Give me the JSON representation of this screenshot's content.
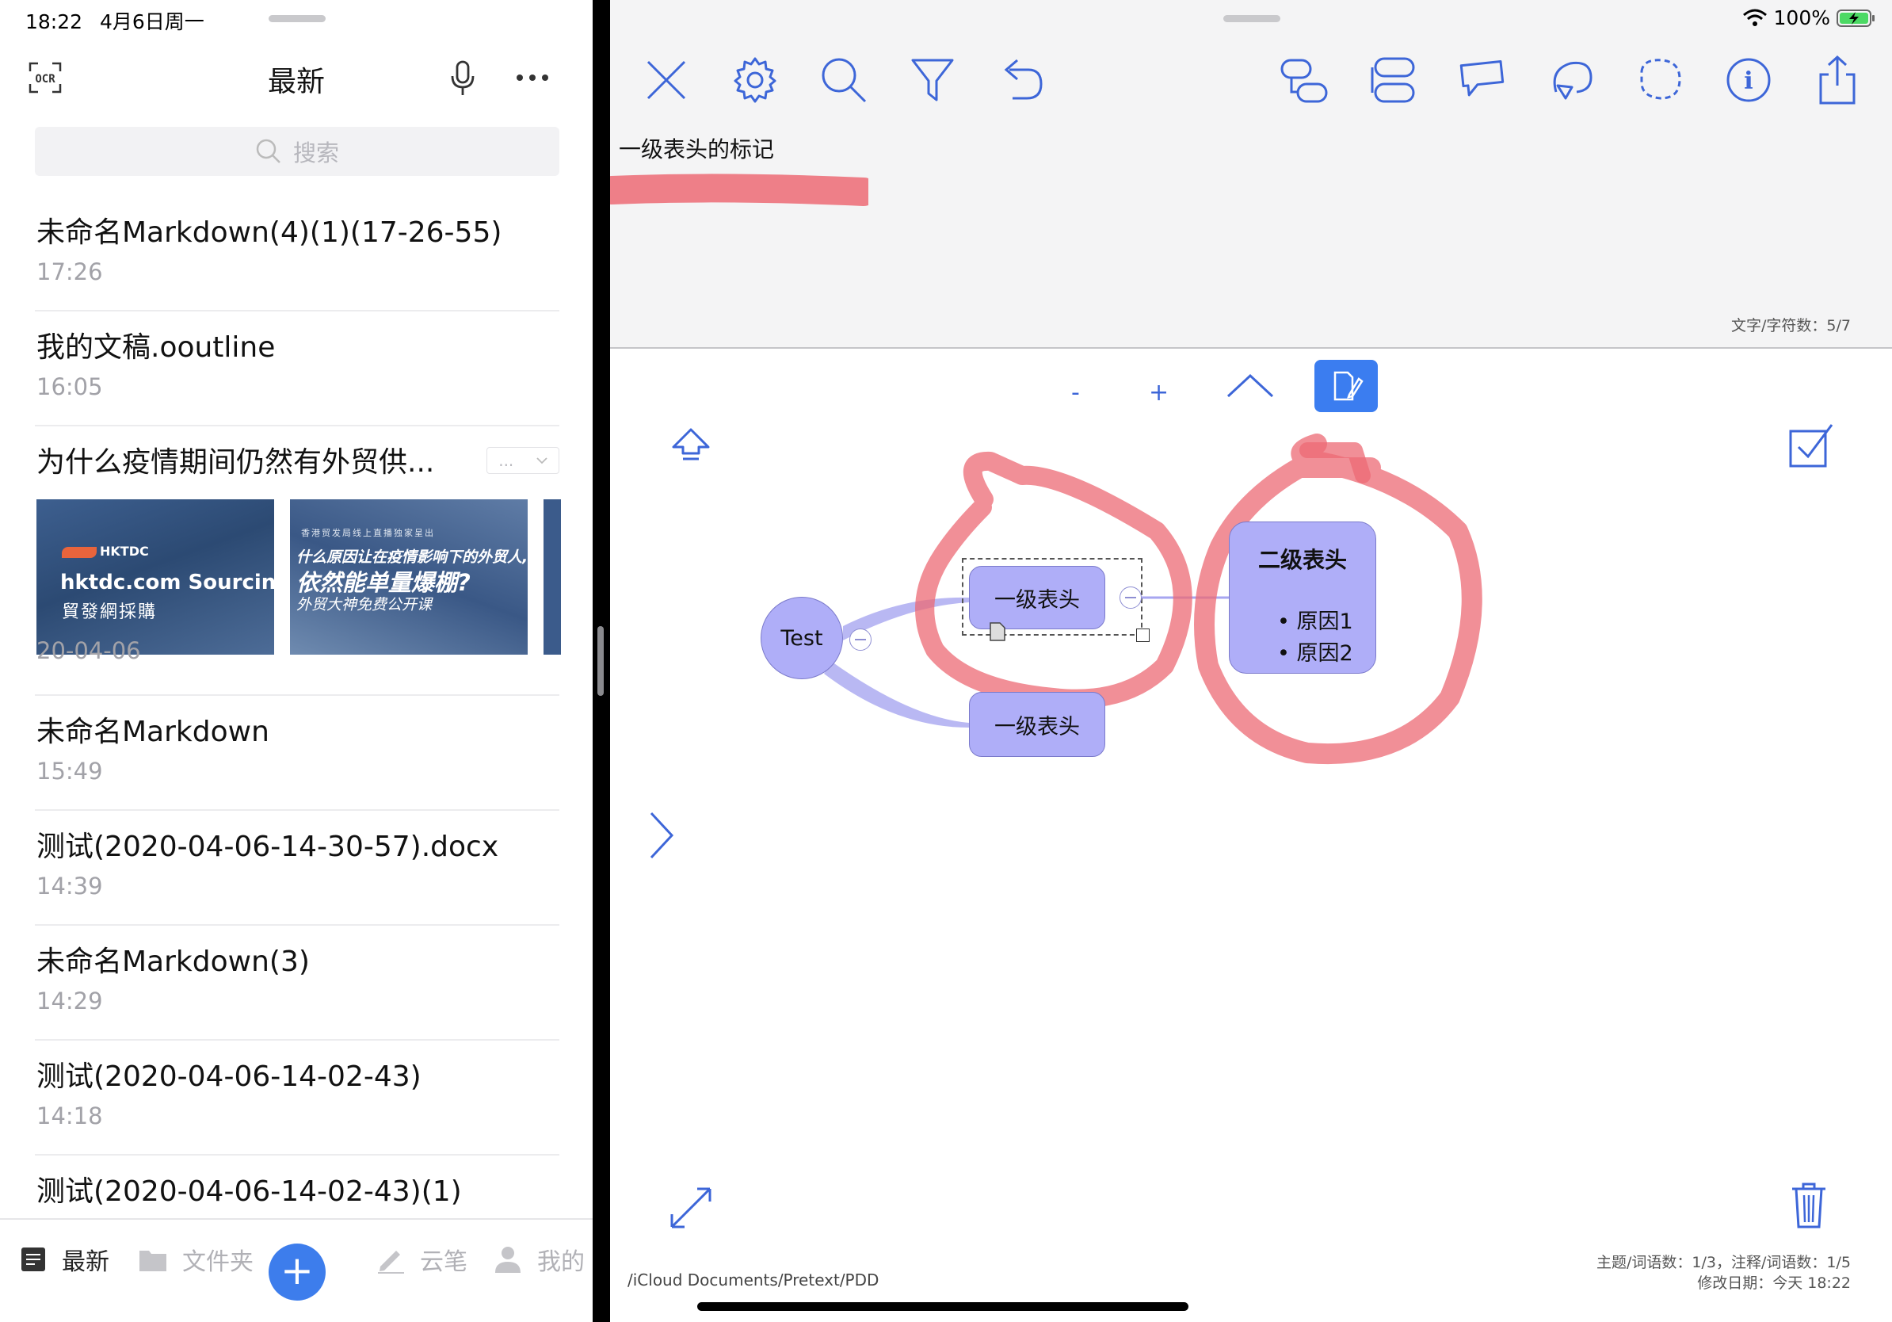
{
  "status_left": {
    "time": "18:22",
    "date": "4月6日周一"
  },
  "status_right": {
    "battery": "100%"
  },
  "left_pane": {
    "title": "最新",
    "search_placeholder": "搜索",
    "documents": [
      {
        "title": "未命名Markdown(4)(1)(17-26-55)",
        "date": "17:26"
      },
      {
        "title": "我的文稿.ooutline",
        "date": "16:05"
      },
      {
        "title": "为什么疫情期间仍然有外贸供...",
        "date": "20-04-06",
        "more": "...",
        "thumb_a": {
          "logo": "HKTDC",
          "line1": "hktdc.com Sourcing",
          "line2": "貿發網採購"
        },
        "thumb_b": {
          "banner": "香港贸发局线上直播独家呈出",
          "line1": "什么原因让在疫情影响下的外贸人,",
          "line2": "依然能单量爆棚?",
          "line3": "外贸大神免费公开课"
        }
      },
      {
        "title": "未命名Markdown",
        "date": "15:49"
      },
      {
        "title": "测试(2020-04-06-14-30-57).docx",
        "date": "14:39"
      },
      {
        "title": "未命名Markdown(3)",
        "date": "14:29"
      },
      {
        "title": "测试(2020-04-06-14-02-43)",
        "date": "14:18"
      },
      {
        "title": "测试(2020-04-06-14-02-43)(1)",
        "date": ""
      }
    ],
    "tabs": {
      "recent": "最新",
      "folder": "文件夹",
      "cloud_pen": "云笔",
      "mine": "我的"
    },
    "fab": "+"
  },
  "right_pane": {
    "note_text": "一级表头的标记",
    "word_count": "文字/字符数：5/7",
    "zoom_out": "-",
    "zoom_in": "+",
    "mindmap": {
      "root": "Test",
      "node1": "一级表头",
      "node2": "一级表头",
      "node3": {
        "title": "二级表头",
        "items": [
          "原因1",
          "原因2"
        ]
      }
    },
    "path": "/iCloud Documents/Pretext/PDD",
    "stats_line1": "主题/词语数：1/3，注释/词语数：1/5",
    "stats_line2": "修改日期：今天 18:22"
  },
  "colors": {
    "accent": "#3b7df0",
    "node_fill": "#afaef8",
    "marker": "#ec6a74",
    "fab": "#3d7dec"
  }
}
